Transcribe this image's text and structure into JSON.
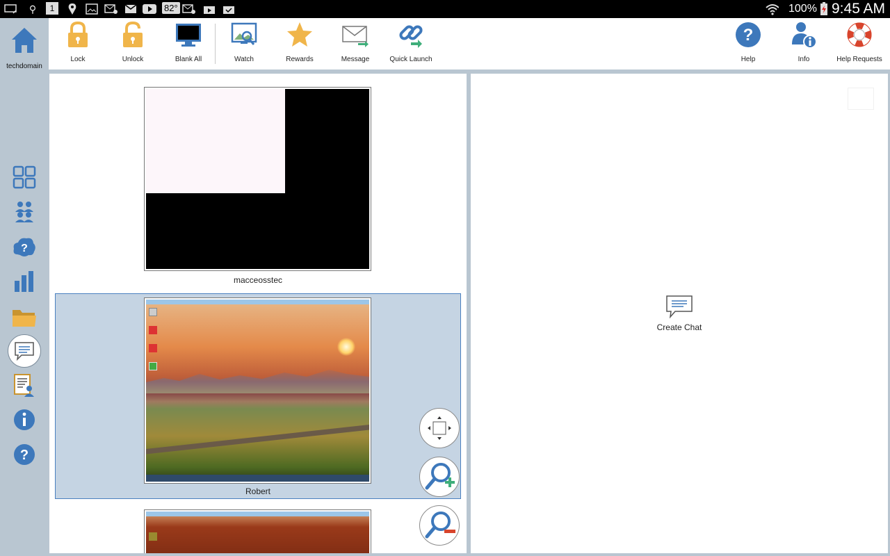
{
  "status_bar": {
    "temperature": "82°",
    "battery_percent": "100%",
    "clock": "9:45 AM",
    "notification_badge": "1"
  },
  "sidebar": {
    "home_label": "techdomain",
    "items": [
      "thumbnails-icon",
      "students-icon",
      "help-cloud-icon",
      "reports-icon",
      "folder-icon",
      "chat-icon",
      "roster-icon",
      "info-icon",
      "help-icon"
    ]
  },
  "toolbar": {
    "lock": "Lock",
    "unlock": "Unlock",
    "blank_all": "Blank All",
    "watch": "Watch",
    "rewards": "Rewards",
    "message": "Message",
    "quick_launch": "Quick Launch",
    "help": "Help",
    "info": "Info",
    "help_requests": "Help Requests"
  },
  "students": [
    {
      "name": "macceosstec"
    },
    {
      "name": "Robert"
    },
    {
      "name": ""
    }
  ],
  "chat": {
    "create_label": "Create Chat"
  },
  "colors": {
    "accent": "#3d78bb",
    "selection": "#c5d4e3",
    "lock": "#f0b54a",
    "panel_bg": "#b9c6d1"
  }
}
